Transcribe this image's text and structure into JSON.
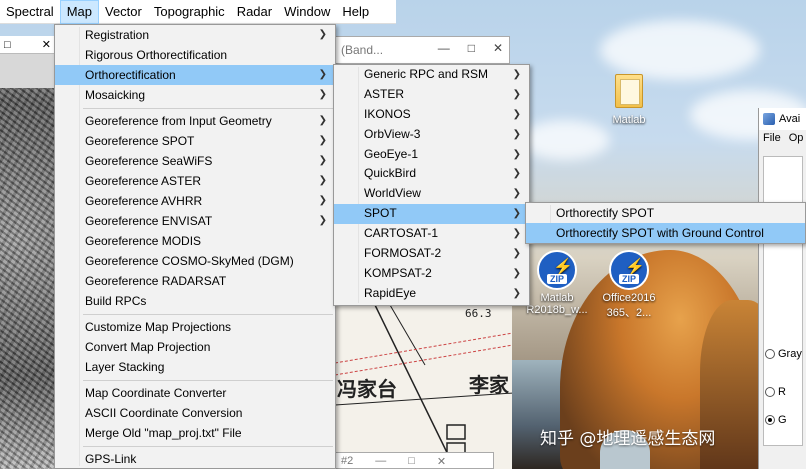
{
  "menubar": {
    "items": [
      {
        "label": "Spectral"
      },
      {
        "label": "Map"
      },
      {
        "label": "Vector"
      },
      {
        "label": "Topographic"
      },
      {
        "label": "Radar"
      },
      {
        "label": "Window"
      },
      {
        "label": "Help"
      }
    ]
  },
  "map_menu": {
    "items": [
      {
        "label": "Registration",
        "submenu": true
      },
      {
        "label": "Rigorous Orthorectification",
        "submenu": false
      },
      {
        "label": "Orthorectification",
        "submenu": true,
        "highlighted": true
      },
      {
        "label": "Mosaicking",
        "submenu": true
      },
      {
        "separator": true
      },
      {
        "label": "Georeference from Input Geometry",
        "submenu": true
      },
      {
        "label": "Georeference SPOT",
        "submenu": true
      },
      {
        "label": "Georeference SeaWiFS",
        "submenu": true
      },
      {
        "label": "Georeference ASTER",
        "submenu": true
      },
      {
        "label": "Georeference AVHRR",
        "submenu": true
      },
      {
        "label": "Georeference ENVISAT",
        "submenu": true
      },
      {
        "label": "Georeference MODIS",
        "submenu": false
      },
      {
        "label": "Georeference COSMO-SkyMed (DGM)",
        "submenu": false
      },
      {
        "label": "Georeference RADARSAT",
        "submenu": false
      },
      {
        "label": "Build RPCs",
        "submenu": false
      },
      {
        "separator": true
      },
      {
        "label": "Customize Map Projections",
        "submenu": false
      },
      {
        "label": "Convert Map Projection",
        "submenu": false
      },
      {
        "label": "Layer Stacking",
        "submenu": false
      },
      {
        "separator": true
      },
      {
        "label": "Map Coordinate Converter",
        "submenu": false
      },
      {
        "label": "ASCII Coordinate Conversion",
        "submenu": false
      },
      {
        "label": "Merge Old \"map_proj.txt\" File",
        "submenu": false
      },
      {
        "separator": true
      },
      {
        "label": "GPS-Link",
        "submenu": false
      }
    ]
  },
  "ortho_menu": {
    "items": [
      {
        "label": "Generic RPC and RSM",
        "submenu": true
      },
      {
        "label": "ASTER",
        "submenu": true
      },
      {
        "label": "IKONOS",
        "submenu": true
      },
      {
        "label": "OrbView-3",
        "submenu": true
      },
      {
        "label": "GeoEye-1",
        "submenu": true
      },
      {
        "label": "QuickBird",
        "submenu": true
      },
      {
        "label": "WorldView",
        "submenu": true
      },
      {
        "label": "SPOT",
        "submenu": true,
        "highlighted": true
      },
      {
        "label": "CARTOSAT-1",
        "submenu": true
      },
      {
        "label": "FORMOSAT-2",
        "submenu": true
      },
      {
        "label": "KOMPSAT-2",
        "submenu": true
      },
      {
        "label": "RapidEye",
        "submenu": true
      }
    ]
  },
  "spot_menu": {
    "items": [
      {
        "label": "Orthorectify SPOT",
        "highlighted": false
      },
      {
        "label": "Orthorectify SPOT with Ground Control",
        "highlighted": true
      }
    ]
  },
  "band_window": {
    "title": "(Band..."
  },
  "desktop_icons": {
    "matlab_folder": {
      "label": "Matlab"
    },
    "matlab_zip": {
      "line1": "Matlab",
      "line2": "R2018b_w...",
      "tag": "ZIP"
    },
    "office_zip": {
      "line1": "Office2016",
      "line2": "365、2...",
      "tag": "ZIP"
    }
  },
  "avail_panel": {
    "title": "Avai",
    "menu_file": "File",
    "menu_op": "Op",
    "gray_label": "Gray",
    "r_label": "R",
    "g_label": "G"
  },
  "map_scan": {
    "text1": "冯家台",
    "text2": "李家",
    "num": "66.3"
  },
  "bottom_window": {
    "title": "#2"
  },
  "watermark": "知乎 @地理遥感生态网"
}
